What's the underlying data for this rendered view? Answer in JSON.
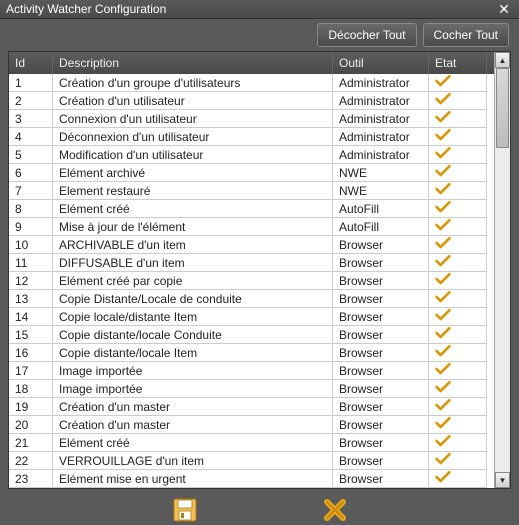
{
  "window": {
    "title": "Activity Watcher Configuration"
  },
  "toolbar": {
    "uncheck_all": "Décocher Tout",
    "check_all": "Cocher Tout"
  },
  "grid": {
    "headers": {
      "id": "Id",
      "description": "Description",
      "tool": "Outil",
      "state": "Etat"
    },
    "rows": [
      {
        "id": "1",
        "description": "Création d'un groupe d'utilisateurs",
        "tool": "Administrator",
        "checked": true
      },
      {
        "id": "2",
        "description": "Création d'un utilisateur",
        "tool": "Administrator",
        "checked": true
      },
      {
        "id": "3",
        "description": "Connexion d'un utilisateur",
        "tool": "Administrator",
        "checked": true
      },
      {
        "id": "4",
        "description": "Déconnexion d'un utilisateur",
        "tool": "Administrator",
        "checked": true
      },
      {
        "id": "5",
        "description": "Modification d'un utilisateur",
        "tool": "Administrator",
        "checked": true
      },
      {
        "id": "6",
        "description": "Elément archivé",
        "tool": "NWE",
        "checked": true
      },
      {
        "id": "7",
        "description": "Element restauré",
        "tool": "NWE",
        "checked": true
      },
      {
        "id": "8",
        "description": "Elément créé",
        "tool": "AutoFill",
        "checked": true
      },
      {
        "id": "9",
        "description": "Mise à jour de l'élément",
        "tool": "AutoFill",
        "checked": true
      },
      {
        "id": "10",
        "description": "ARCHIVABLE d'un item",
        "tool": "Browser",
        "checked": true
      },
      {
        "id": "11",
        "description": "DIFFUSABLE d'un item",
        "tool": "Browser",
        "checked": true
      },
      {
        "id": "12",
        "description": "Elément créé par copie",
        "tool": "Browser",
        "checked": true
      },
      {
        "id": "13",
        "description": "Copie Distante/Locale de conduite",
        "tool": "Browser",
        "checked": true
      },
      {
        "id": "14",
        "description": "Copie locale/distante Item",
        "tool": "Browser",
        "checked": true
      },
      {
        "id": "15",
        "description": "Copie distante/locale Conduite",
        "tool": "Browser",
        "checked": true
      },
      {
        "id": "16",
        "description": "Copie distante/locale Item",
        "tool": "Browser",
        "checked": true
      },
      {
        "id": "17",
        "description": "Image importée",
        "tool": "Browser",
        "checked": true
      },
      {
        "id": "18",
        "description": "Image importée",
        "tool": "Browser",
        "checked": true
      },
      {
        "id": "19",
        "description": "Création d'un master",
        "tool": "Browser",
        "checked": true
      },
      {
        "id": "20",
        "description": "Création d'un master",
        "tool": "Browser",
        "checked": true
      },
      {
        "id": "21",
        "description": "Elément créé",
        "tool": "Browser",
        "checked": true
      },
      {
        "id": "22",
        "description": "VERROUILLAGE d'un item",
        "tool": "Browser",
        "checked": true
      },
      {
        "id": "23",
        "description": "Elément mise en urgent",
        "tool": "Browser",
        "checked": true
      }
    ]
  },
  "icons": {
    "save": "save-icon",
    "cancel": "cancel-icon"
  },
  "colors": {
    "check": "#e6a817",
    "cancel": "#e6a817",
    "savebody": "#f2c057"
  }
}
